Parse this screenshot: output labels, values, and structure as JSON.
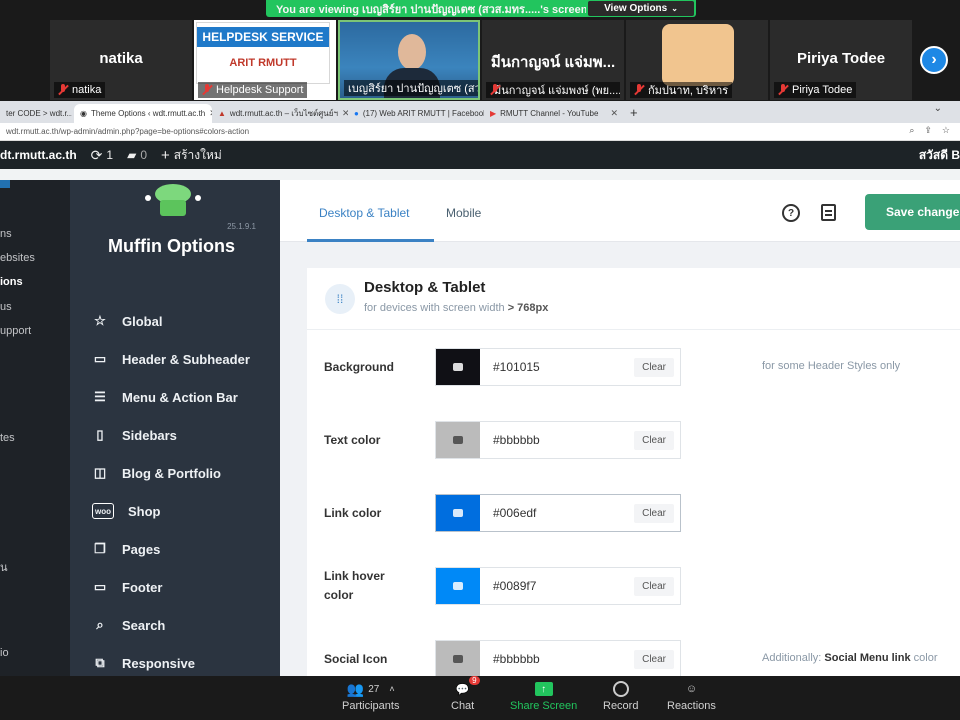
{
  "zoom": {
    "banner_text": "You  are viewing เบญสิร์ยา ปานปัญญเตซ (สวส.มทร.....'s screen",
    "view_options": "View Options",
    "participants": [
      {
        "name": "natika",
        "label": "natika"
      },
      {
        "name": "",
        "label": "Helpdesk Support",
        "art_title": "HELPDESK SERVICE",
        "art_sub": "ARIT RMUTT"
      },
      {
        "name": "",
        "label": "เบญสิร์ยา ปานปัญญเตซ (สวส..."
      },
      {
        "name": "มีนกาญจน์ แจ่มพ...",
        "label": "มีนกาญจน์ แจ่มพงษ์ (พย...."
      },
      {
        "name": "",
        "label": "กัมปนาท, บริหาร"
      },
      {
        "name": "Piriya Todee",
        "label": "Piriya Todee"
      }
    ],
    "toolbar": {
      "participants_label": "Participants",
      "participants_count": "27",
      "chat_label": "Chat",
      "chat_badge": "9",
      "share_label": "Share Screen",
      "record_label": "Record",
      "reactions_label": "Reactions"
    }
  },
  "browser": {
    "tabs": [
      {
        "label": "ter CODE > wdt.r..."
      },
      {
        "label": "Theme Options ‹ wdt.rmutt.ac.th"
      },
      {
        "label": "wdt.rmutt.ac.th – เว็บไซต์ศูนย์ฯ"
      },
      {
        "label": "(17) Web ARIT RMUTT | Facebook"
      },
      {
        "label": "RMUTT Channel - YouTube"
      }
    ],
    "url": "wdt.rmutt.ac.th/wp-admin/admin.php?page=be-options#colors-action"
  },
  "wpbar": {
    "site": "dt.rmutt.ac.th",
    "updates": "1",
    "comments": "0",
    "new_label": "สร้างใหม่",
    "greeting": "สวัสดี B"
  },
  "wp_sidebar": [
    {
      "label": "ns"
    },
    {
      "label": "ebsites"
    },
    {
      "label": "ions",
      "current": true
    },
    {
      "label": "us"
    },
    {
      "label": "upport"
    },
    {
      "label": "tes"
    },
    {
      "label": "น"
    },
    {
      "label": "io"
    }
  ],
  "muffin": {
    "version": "25.1.9.1",
    "title": "Muffin Options",
    "nav": [
      {
        "label": "Global",
        "icon": "star-icon"
      },
      {
        "label": "Header & Subheader",
        "icon": "header-icon"
      },
      {
        "label": "Menu & Action Bar",
        "icon": "menu-icon"
      },
      {
        "label": "Sidebars",
        "icon": "sidebar-icon"
      },
      {
        "label": "Blog & Portfolio",
        "icon": "blog-icon"
      },
      {
        "label": "Shop",
        "icon": "woo-icon"
      },
      {
        "label": "Pages",
        "icon": "pages-icon"
      },
      {
        "label": "Footer",
        "icon": "footer-icon"
      },
      {
        "label": "Search",
        "icon": "search-icon"
      },
      {
        "label": "Responsive",
        "icon": "responsive-icon"
      }
    ]
  },
  "content": {
    "tabs": [
      "Desktop & Tablet",
      "Mobile"
    ],
    "save_label": "Save changes",
    "panel_title": "Desktop & Tablet",
    "panel_sub_prefix": "for devices with screen width",
    "panel_sub_value": "> 768px",
    "rows": [
      {
        "label": "Background",
        "hex": "#101015",
        "swatch": "#101015",
        "clear": "Clear",
        "note": "for some Header Styles only"
      },
      {
        "label": "Text color",
        "hex": "#bbbbbb",
        "swatch": "#bbbbbb",
        "clear": "Clear",
        "note": ""
      },
      {
        "label": "Link color",
        "hex": "#006edf",
        "swatch": "#006edf",
        "clear": "Clear",
        "note": ""
      },
      {
        "label": "Link hover color",
        "hex": "#0089f7",
        "swatch": "#0089f7",
        "clear": "Clear",
        "note": ""
      },
      {
        "label": "Social Icon",
        "hex": "#bbbbbb",
        "swatch": "#bbbbbb",
        "clear": "Clear",
        "note_prefix": "Additionally:",
        "note_bold": "Social Menu link",
        "note_suffix": "color"
      }
    ]
  }
}
